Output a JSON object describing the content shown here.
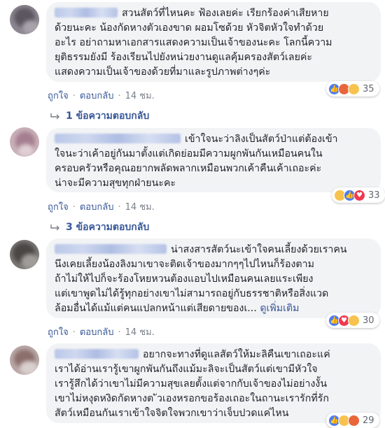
{
  "comments": [
    {
      "lines": [
        "สวนสัตว์ที่ไหนคะ ฟ้องเลยค่ะ เรียกร้องค่าเสียหาย",
        "ด้วยนะคะ น้องกัดหางตัวเองขาด ผอมโซด้วย หัวจิตหัวใจทำด้วย",
        "อะไร อย่าถามหาเอกสารแสดงความเป็นเจ้าของนะคะ โลกนี้ความ",
        "ยุติธรรมยังมี ร้องเรียนไปยังหน่วยงานดูแลคุ้มครองสัตว์เลยค่ะ",
        "แสดงความเป็นเจ้าของด้วยที่มาและรูปภาพต่างๆค่ะ"
      ],
      "like": "ถูกใจ",
      "reply": "ตอบกลับ",
      "time": "14 ชม.",
      "reaction_count": "35",
      "reactions": [
        "like-icon",
        "angry-icon",
        "sad-icon"
      ],
      "replies_label": "1 ข้อความตอบกลับ"
    },
    {
      "lines": [
        "เข้าใจนะว่าลิงเป็นสัตว์ป่าแต่ต้องเข้า",
        "ใจนะว่าเค้าอยู่กันมาตั้งแต่เกิดย่อมมีความผูกพันกันเหมือนคนใน",
        "ครอบครัวหรือคุณอยากพลัดพลากเหมือนพวกเค้าคืนเค้าเถอะค่ะ",
        "น่าจะมีความสุขทุกฝ่ายนะคะ"
      ],
      "like": "ถูกใจ",
      "reply": "ตอบกลับ",
      "time": "14 ชม.",
      "reaction_count": "33",
      "reactions": [
        "haha-icon",
        "like-icon",
        "love-icon"
      ],
      "replies_label": "3 ข้อความตอบกลับ"
    },
    {
      "lines": [
        "น่าสงสารสัตว์นะเข้าใจคนเลี้ยงด้วยเราคน",
        "นึงเคยเลี้ยงน้องลิงมาเขาจะติดเจ้าของมากๆๆไปไหนก็ร้องตาม",
        "ถ้าไม่ให้ไปก็จะร้องโหยหวนต้องแอบไปเหมือนคนเลยแระเพียง",
        "แต่เขาพูดไม่ได้รู้ทุกอย่างเขาไม่สามารถอยู่กับธรรชาติหรือสิ่งแวด",
        "ล้อมอื่นได้แม้แต่คนแปลกหน้าแต่เสียดายของเ..."
      ],
      "see_more": "ดูเพิ่มเติม",
      "like": "ถูกใจ",
      "reply": "ตอบกลับ",
      "time": "14 ชม.",
      "reaction_count": "30",
      "reactions": [
        "like-icon",
        "love-icon",
        "haha-icon"
      ]
    },
    {
      "lines": [
        "อยากจะทางที่ดูแลสัตว์ให้มะลิคืนเขาเถอะแค่",
        "เราได้อ่านเรารู้เขาผูกพันกันถึงแม้มะลิจะเป็นสัตว์แต่เขามีหัวใจ",
        "เรารู้สึกได้ว่าเขาไม่มีความสุขเลยตั้งแต่จากกับเจ้าของไม่อย่างงั้น",
        "เขาไม่หงุดหงิดกัดหางต ัวเองหรอกขอร้องเถอะในถานะเรารักที่รัก",
        "สัตว์เหมือนกันเราเข้าใจจิตใจพวกเขาว่าเจ็บปวดแค่ไหน"
      ],
      "reaction_count": "29",
      "reactions": [
        "like-icon",
        "sad-icon",
        "angry-icon"
      ]
    }
  ],
  "colors": {
    "link": "#385898",
    "bubble": "#f2f3f5",
    "meta": "#90949c"
  }
}
